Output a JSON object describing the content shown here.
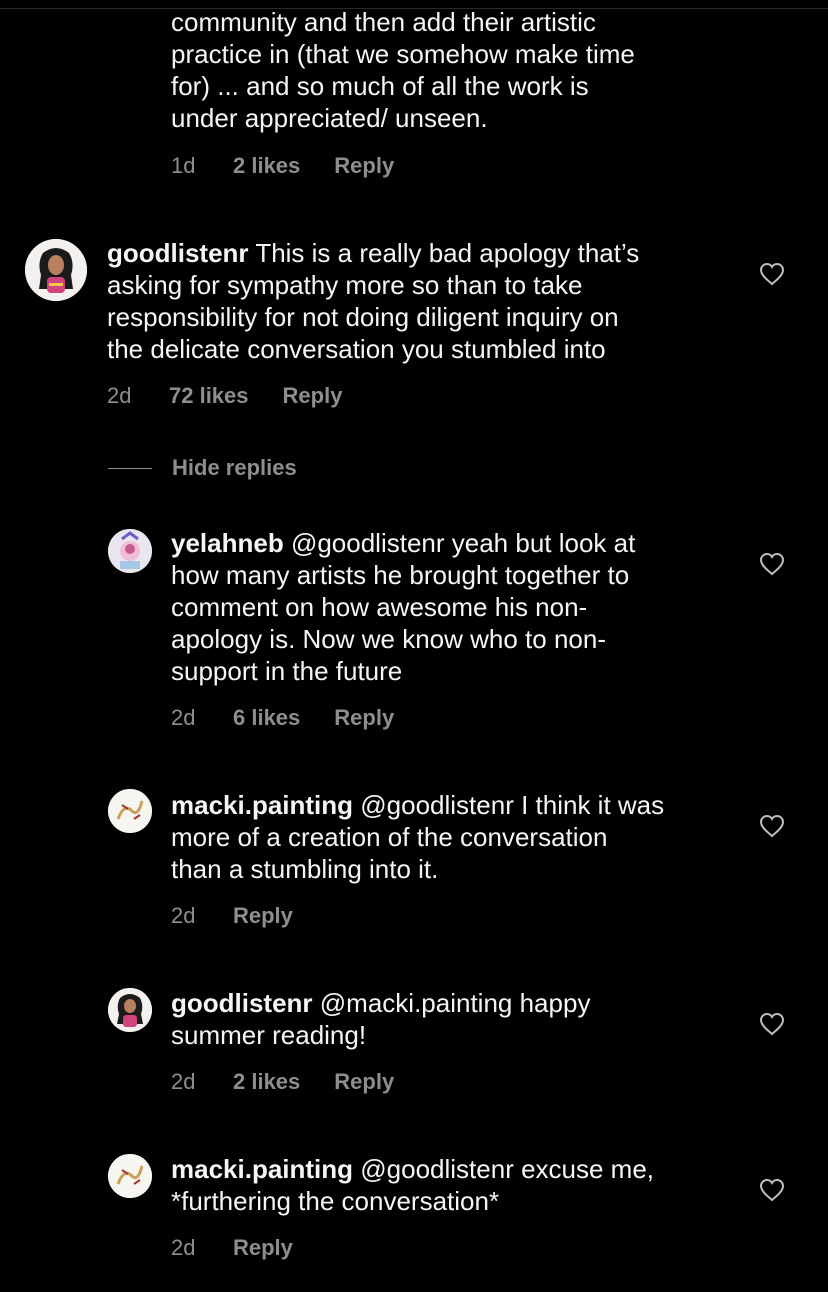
{
  "comments": {
    "top": {
      "lines": [
        "community and then add their artistic",
        "practice in (that we somehow make time",
        "for) ... and so much of all the work is",
        "under appreciated/ unseen."
      ],
      "time": "1d",
      "likes": "2 likes",
      "reply": "Reply"
    },
    "c1": {
      "user": "goodlistenr",
      "lines": [
        " This is a really bad apology that’s",
        "asking for sympathy more so than to take",
        "responsibility for not doing diligent inquiry on",
        "the delicate conversation you stumbled into"
      ],
      "time": "2d",
      "likes": "72 likes",
      "reply": "Reply",
      "avatar_icon": "profile-avatar-icon",
      "like_icon": "heart-icon"
    },
    "hide_replies": "Hide replies",
    "r1": {
      "user": "yelahneb",
      "lines": [
        " @goodlistenr yeah but look at",
        "how many artists he brought together to",
        "comment on how awesome his non-",
        "apology is. Now we know who to non-",
        "support in the future"
      ],
      "time": "2d",
      "likes": "6 likes",
      "reply": "Reply"
    },
    "r2": {
      "user": "macki.painting",
      "lines": [
        " @goodlistenr I think it was",
        "more of a creation of the conversation",
        "than a stumbling into it."
      ],
      "time": "2d",
      "reply": "Reply"
    },
    "r3": {
      "user": "goodlistenr",
      "lines": [
        " @macki.painting happy",
        "summer reading!"
      ],
      "time": "2d",
      "likes": "2 likes",
      "reply": "Reply"
    },
    "r4": {
      "user": "macki.painting",
      "lines": [
        " @goodlistenr excuse me,",
        "*furthering the conversation*"
      ],
      "time": "2d",
      "reply": "Reply"
    }
  },
  "colors": {
    "background": "#000000",
    "text": "#f5f5f5",
    "muted": "#8e8e8e"
  }
}
